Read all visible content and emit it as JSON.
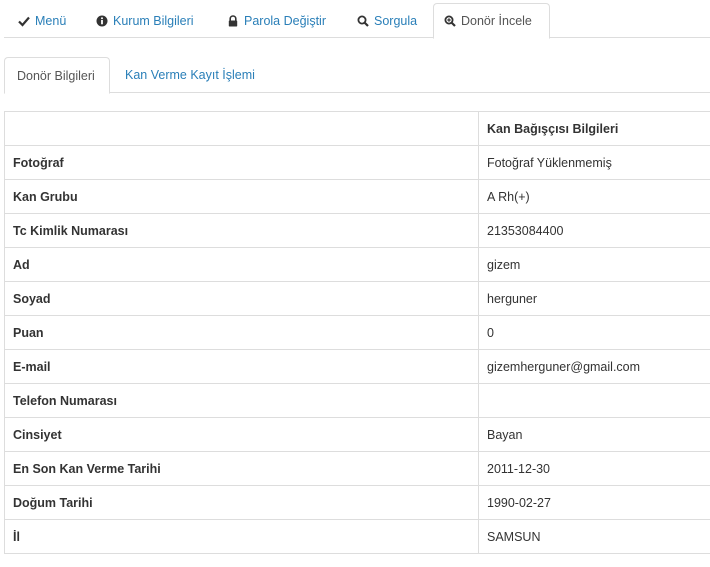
{
  "main_tabs": [
    {
      "label": "Menü",
      "icon": "check-icon"
    },
    {
      "label": "Kurum Bilgileri",
      "icon": "info-icon"
    },
    {
      "label": "Parola Değiştir",
      "icon": "lock-icon"
    },
    {
      "label": "Sorgula",
      "icon": "search-icon"
    },
    {
      "label": "Donör İncele",
      "icon": "zoom-in-icon"
    }
  ],
  "active_main_tab": "Donör İncele",
  "sub_tabs": [
    {
      "label": "Donör Bilgileri"
    },
    {
      "label": "Kan Verme Kayıt İşlemi"
    }
  ],
  "active_sub_tab": "Donör Bilgileri",
  "table": {
    "header": {
      "col1": "",
      "col2": "Kan Bağışçısı Bilgileri"
    },
    "rows": [
      {
        "label": "Fotoğraf",
        "value": "Fotoğraf Yüklenmemiş"
      },
      {
        "label": "Kan Grubu",
        "value": "A Rh(+)"
      },
      {
        "label": "Tc Kimlik Numarası",
        "value": "21353084400"
      },
      {
        "label": "Ad",
        "value": "gizem"
      },
      {
        "label": "Soyad",
        "value": "herguner"
      },
      {
        "label": "Puan",
        "value": "0"
      },
      {
        "label": "E-mail",
        "value": "gizemherguner@gmail.com"
      },
      {
        "label": "Telefon Numarası",
        "value": ""
      },
      {
        "label": "Cinsiyet",
        "value": "Bayan"
      },
      {
        "label": "En Son Kan Verme Tarihi",
        "value": "2011-12-30"
      },
      {
        "label": "Doğum Tarihi",
        "value": "1990-02-27"
      },
      {
        "label": "İl",
        "value": "SAMSUN"
      }
    ]
  },
  "colors": {
    "link": "#2a7fb8",
    "border": "#dddddd",
    "text": "#333333"
  }
}
